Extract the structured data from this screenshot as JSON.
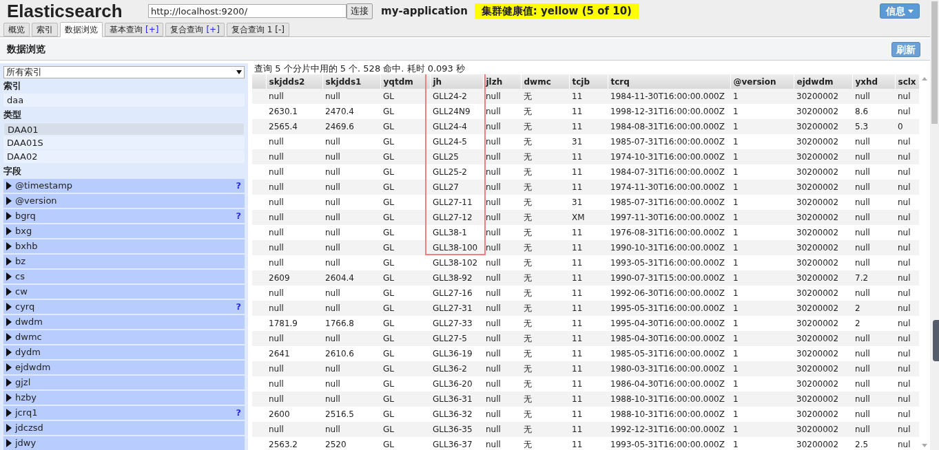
{
  "app": {
    "title": "Elasticsearch",
    "url": "http://localhost:9200/",
    "connect_button": "连接",
    "cluster_name": "my-application",
    "health": {
      "text": "集群健康值: yellow (5 of 10)",
      "color": "#ffff00"
    },
    "info_button": "信息"
  },
  "tabs": [
    {
      "label": "概览",
      "selected": false
    },
    {
      "label": "索引",
      "selected": false
    },
    {
      "label": "数据浏览",
      "selected": true
    },
    {
      "label": "基本查询",
      "action": "[+]",
      "kind": "add",
      "selected": false
    },
    {
      "label": "复合查询",
      "action": "[+]",
      "kind": "add",
      "selected": false
    },
    {
      "label": "复合查询 1",
      "action": "[-]",
      "kind": "remove",
      "selected": false
    }
  ],
  "panel": {
    "title": "数据浏览",
    "refresh_button": "刷新"
  },
  "sidebar": {
    "index_select": "所有索引",
    "index_heading": "索引",
    "indices": [
      {
        "label": "daa",
        "selected": false
      }
    ],
    "type_heading": "类型",
    "types": [
      {
        "label": "DAA01",
        "selected": true
      },
      {
        "label": "DAA01S",
        "selected": false
      },
      {
        "label": "DAA02",
        "selected": false
      }
    ],
    "field_heading": "字段",
    "fields": [
      {
        "name": "@timestamp",
        "help": "?"
      },
      {
        "name": "@version"
      },
      {
        "name": "bgrq",
        "help": "?"
      },
      {
        "name": "bxg"
      },
      {
        "name": "bxhb"
      },
      {
        "name": "bz"
      },
      {
        "name": "cs"
      },
      {
        "name": "cw"
      },
      {
        "name": "cyrq",
        "help": "?"
      },
      {
        "name": "dwdm"
      },
      {
        "name": "dwmc"
      },
      {
        "name": "dydm"
      },
      {
        "name": "ejdwdm"
      },
      {
        "name": "gjzl"
      },
      {
        "name": "hzby"
      },
      {
        "name": "jcrq1",
        "help": "?"
      },
      {
        "name": "jdczsd"
      },
      {
        "name": "jdwy"
      }
    ]
  },
  "results": {
    "summary": "查询 5 个分片中用的 5 个. 528 命中. 耗时 0.093 秒",
    "columns": [
      "skjdds2",
      "skjdds1",
      "yqtdm",
      "jh",
      "jlzh",
      "dwmc",
      "tcjb",
      "tcrq",
      "@version",
      "ejdwdm",
      "yxhd",
      "sclx"
    ],
    "rows": [
      [
        "null",
        "null",
        "GL",
        "GLL24-2",
        "null",
        "无",
        "11",
        "1984-11-30T16:00:00.000Z",
        "1",
        "30200002",
        "null",
        "nul"
      ],
      [
        "2630.1",
        "2470.4",
        "GL",
        "GLL24N9",
        "null",
        "无",
        "11",
        "1998-12-31T16:00:00.000Z",
        "1",
        "30200002",
        "8.6",
        "nul"
      ],
      [
        "2565.4",
        "2469.6",
        "GL",
        "GLL24-4",
        "null",
        "无",
        "11",
        "1984-08-31T16:00:00.000Z",
        "1",
        "30200002",
        "5.3",
        "0"
      ],
      [
        "null",
        "null",
        "GL",
        "GLL24-5",
        "null",
        "无",
        "31",
        "1985-07-31T16:00:00.000Z",
        "1",
        "30200002",
        "null",
        "nul"
      ],
      [
        "null",
        "null",
        "GL",
        "GLL25",
        "null",
        "无",
        "11",
        "1974-10-31T16:00:00.000Z",
        "1",
        "30200002",
        "null",
        "nul"
      ],
      [
        "null",
        "null",
        "GL",
        "GLL25-2",
        "null",
        "无",
        "11",
        "1984-07-31T16:00:00.000Z",
        "1",
        "30200002",
        "null",
        "nul"
      ],
      [
        "null",
        "null",
        "GL",
        "GLL27",
        "null",
        "无",
        "11",
        "1974-11-30T16:00:00.000Z",
        "1",
        "30200002",
        "null",
        "nul"
      ],
      [
        "null",
        "null",
        "GL",
        "GLL27-11",
        "null",
        "无",
        "31",
        "1985-07-31T16:00:00.000Z",
        "1",
        "30200002",
        "null",
        "nul"
      ],
      [
        "null",
        "null",
        "GL",
        "GLL27-12",
        "null",
        "无",
        "XM",
        "1997-11-30T16:00:00.000Z",
        "1",
        "30200002",
        "null",
        "nul"
      ],
      [
        "null",
        "null",
        "GL",
        "GLL38-1",
        "null",
        "无",
        "11",
        "1976-08-31T16:00:00.000Z",
        "1",
        "30200002",
        "null",
        "nul"
      ],
      [
        "null",
        "null",
        "GL",
        "GLL38-100",
        "null",
        "无",
        "11",
        "1990-10-31T16:00:00.000Z",
        "1",
        "30200002",
        "null",
        "nul"
      ],
      [
        "null",
        "null",
        "GL",
        "GLL38-102",
        "null",
        "无",
        "11",
        "1993-05-31T16:00:00.000Z",
        "1",
        "30200002",
        "null",
        "nul"
      ],
      [
        "2609",
        "2604.4",
        "GL",
        "GLL38-92",
        "null",
        "无",
        "11",
        "1990-07-31T15:00:00.000Z",
        "1",
        "30200002",
        "7.2",
        "nul"
      ],
      [
        "null",
        "null",
        "GL",
        "GLL27-16",
        "null",
        "无",
        "11",
        "1992-06-30T16:00:00.000Z",
        "1",
        "30200002",
        "null",
        "nul"
      ],
      [
        "null",
        "null",
        "GL",
        "GLL27-31",
        "null",
        "无",
        "11",
        "1995-05-31T16:00:00.000Z",
        "1",
        "30200002",
        "2",
        "nul"
      ],
      [
        "1781.9",
        "1766.8",
        "GL",
        "GLL27-33",
        "null",
        "无",
        "11",
        "1995-04-30T16:00:00.000Z",
        "1",
        "30200002",
        "2",
        "nul"
      ],
      [
        "null",
        "null",
        "GL",
        "GLL27-5",
        "null",
        "无",
        "11",
        "1985-04-30T16:00:00.000Z",
        "1",
        "30200002",
        "null",
        "nul"
      ],
      [
        "2641",
        "2610.6",
        "GL",
        "GLL36-19",
        "null",
        "无",
        "11",
        "1985-05-31T16:00:00.000Z",
        "1",
        "30200002",
        "null",
        "nul"
      ],
      [
        "null",
        "null",
        "GL",
        "GLL36-2",
        "null",
        "无",
        "11",
        "1980-03-31T16:00:00.000Z",
        "1",
        "30200002",
        "null",
        "nul"
      ],
      [
        "null",
        "null",
        "GL",
        "GLL36-20",
        "null",
        "无",
        "11",
        "1986-04-30T16:00:00.000Z",
        "1",
        "30200002",
        "null",
        "nul"
      ],
      [
        "null",
        "null",
        "GL",
        "GLL36-31",
        "null",
        "无",
        "11",
        "1988-10-31T16:00:00.000Z",
        "1",
        "30200002",
        "null",
        "nul"
      ],
      [
        "2600",
        "2516.5",
        "GL",
        "GLL36-32",
        "null",
        "无",
        "11",
        "1988-10-31T16:00:00.000Z",
        "1",
        "30200002",
        "null",
        "nul"
      ],
      [
        "null",
        "null",
        "GL",
        "GLL36-35",
        "null",
        "无",
        "11",
        "1992-12-31T16:00:00.000Z",
        "1",
        "30200002",
        "null",
        "nul"
      ],
      [
        "2563.2",
        "2520",
        "GL",
        "GLL36-37",
        "null",
        "无",
        "11",
        "1993-05-31T16:00:00.000Z",
        "1",
        "30200002",
        "2.5",
        "nul"
      ]
    ]
  }
}
